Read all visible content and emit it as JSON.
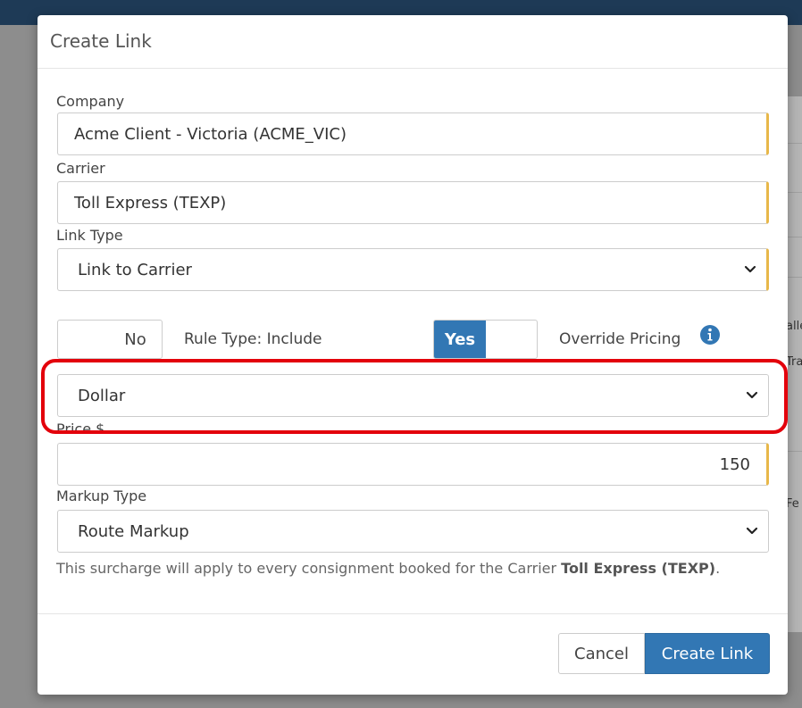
{
  "background": {
    "fragments": [
      "alle",
      "Tra",
      "Fe"
    ]
  },
  "modal": {
    "title": "Create Link",
    "company": {
      "label": "Company",
      "value": "Acme Client - Victoria (ACME_VIC)"
    },
    "carrier": {
      "label": "Carrier",
      "value": "Toll Express (TEXP)"
    },
    "link_type": {
      "label": "Link Type",
      "value": "Link to Carrier"
    },
    "rule_toggle": {
      "state": "No",
      "label": "Rule Type: Include"
    },
    "override_toggle": {
      "state": "Yes",
      "label": "Override Pricing"
    },
    "pricing_type": {
      "value": "Dollar"
    },
    "price": {
      "label": "Price $",
      "value": "150"
    },
    "markup_type": {
      "label": "Markup Type",
      "value": "Route Markup"
    },
    "help_text": {
      "prefix": "This surcharge will apply to every consignment booked for the Carrier ",
      "carrier": "Toll Express (TEXP)",
      "suffix": "."
    },
    "buttons": {
      "cancel": "Cancel",
      "create": "Create Link"
    }
  },
  "colors": {
    "primary": "#3277b4",
    "required_marker": "#e8b84a",
    "highlight": "#e3000b"
  }
}
